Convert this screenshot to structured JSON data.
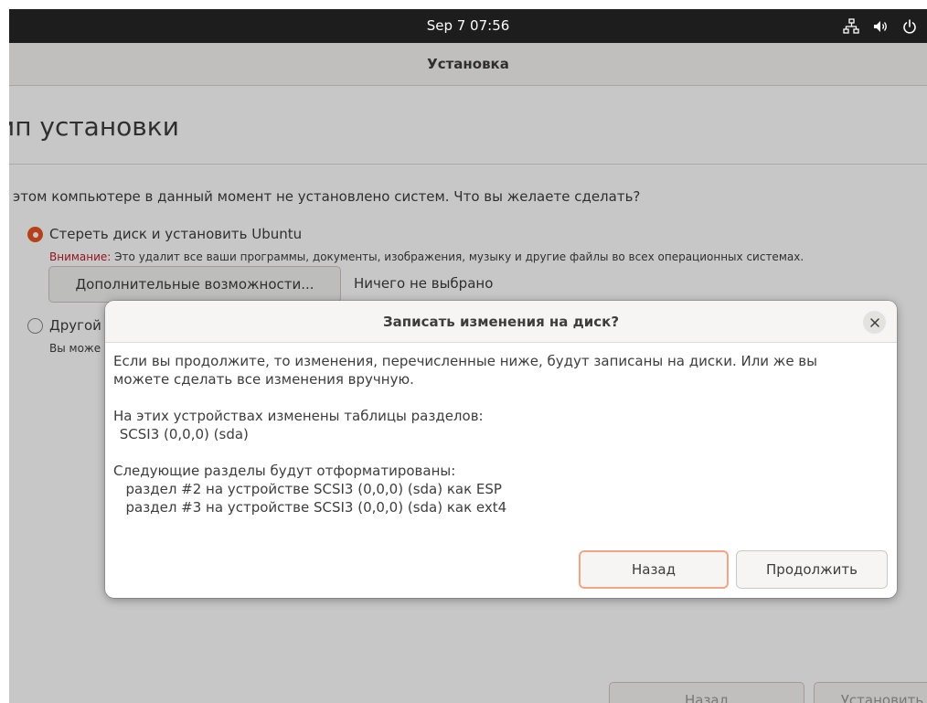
{
  "topbar": {
    "clock": "Sep 7  07:56",
    "tray_icons": [
      "network-icon",
      "volume-icon",
      "power-icon"
    ]
  },
  "window": {
    "title": "Установка"
  },
  "page": {
    "heading": "ип установки",
    "question": "а этом компьютере в данный момент не установлено систем. Что вы желаете сделать?",
    "erase_option": {
      "label": "Стереть диск и установить Ubuntu",
      "selected": true,
      "warning_prefix": "Внимание:",
      "warning_text": " Это удалит все ваши программы, документы, изображения, музыку и другие файлы во всех операционных системах."
    },
    "advanced_button": "Дополнительные возможности...",
    "advanced_status": "Ничего не выбрано",
    "other_option": {
      "label": "Другой",
      "description": "Вы може",
      "selected": false
    },
    "bottom_buttons": {
      "back": "Назад",
      "install": "Установить"
    }
  },
  "dialog": {
    "title": "Записать изменения на диск?",
    "intro_line1": "Если вы продолжите, то изменения, перечисленные ниже, будут записаны на диски. Или же вы",
    "intro_line2": "можете сделать все изменения вручную.",
    "tables_header": "На этих устройствах изменены таблицы разделов:",
    "tables_items": [
      " SCSI3 (0,0,0) (sda)"
    ],
    "format_header": "Следующие разделы будут отформатированы:",
    "format_items": [
      "  раздел #2 на устройстве SCSI3 (0,0,0) (sda) как ESP",
      "  раздел #3 на устройстве SCSI3 (0,0,0) (sda) как ext4"
    ],
    "back_button": "Назад",
    "continue_button": "Продолжить"
  },
  "colors": {
    "accent": "#e95420",
    "warning": "#c01c28",
    "topbar": "#1d1d1d",
    "focus_ring": "#f0a685"
  }
}
